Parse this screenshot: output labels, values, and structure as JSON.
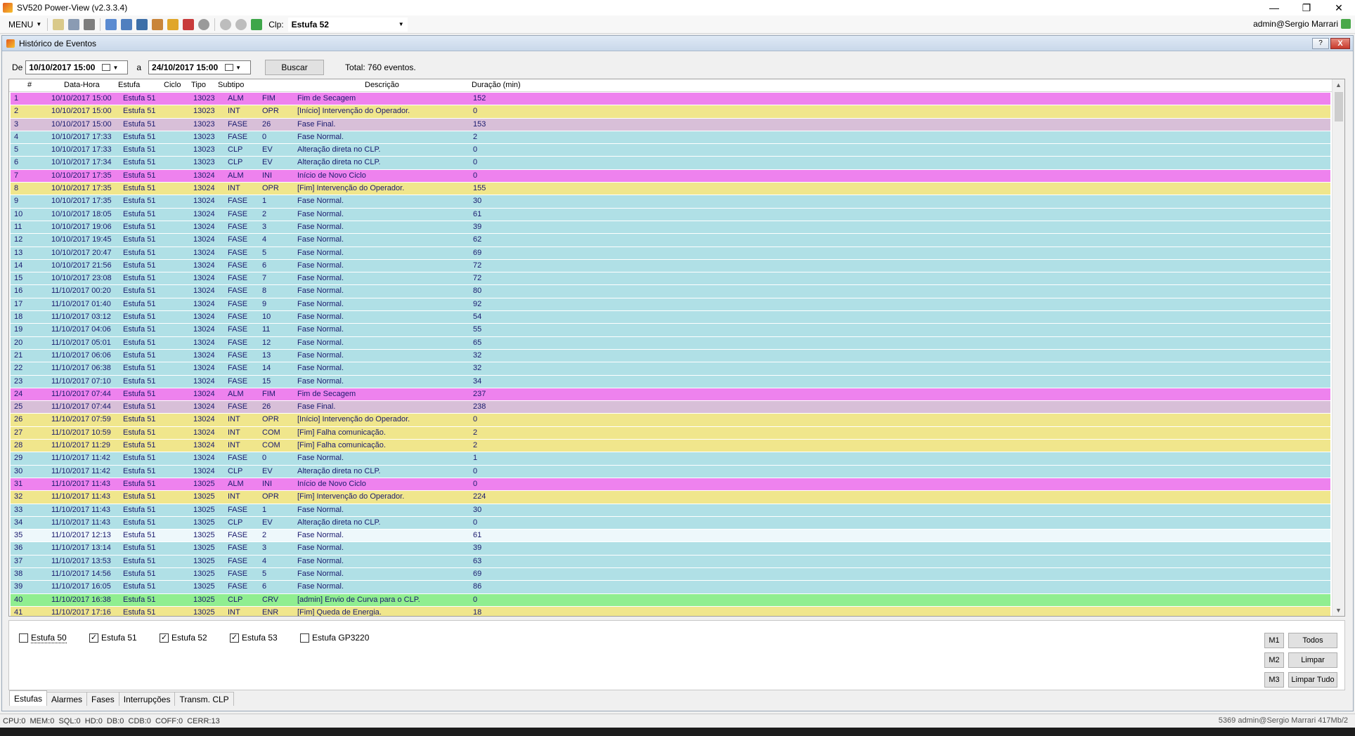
{
  "window": {
    "title": "SV520 Power-View (v2.3.3.4)",
    "minimize_glyph": "—",
    "restore_glyph": "❐",
    "close_glyph": "✕"
  },
  "toolbar": {
    "menu_label": "MENU",
    "clp_label": "Clp:",
    "clp_value": "Estufa 52",
    "user": "admin@Sergio Marrari"
  },
  "inner_window": {
    "title": "Histórico de Eventos",
    "help_label": "?",
    "close_label": "X"
  },
  "filter": {
    "from_label": "De",
    "from_value": "10/10/2017 15:00",
    "to_label": "a",
    "to_value": "24/10/2017 15:00",
    "search_label": "Buscar",
    "total_text": "Total: 760 eventos."
  },
  "grid": {
    "columns": [
      "#",
      "Data-Hora",
      "Estufa",
      "Ciclo",
      "Tipo",
      "Subtipo",
      "Descrição",
      "Duração (min)"
    ],
    "rows": [
      {
        "n": "1",
        "dt": "10/10/2017 15:00",
        "est": "Estufa 51",
        "ciclo": "13023",
        "tipo": "ALM",
        "sub": "FIM",
        "desc": "Fim de Secagem",
        "dur": "152",
        "color": "#ee82ee"
      },
      {
        "n": "2",
        "dt": "10/10/2017 15:00",
        "est": "Estufa 51",
        "ciclo": "13023",
        "tipo": "INT",
        "sub": "OPR",
        "desc": "[Início] Intervenção do Operador.",
        "dur": "0",
        "color": "#f0e68c"
      },
      {
        "n": "3",
        "dt": "10/10/2017 15:00",
        "est": "Estufa 51",
        "ciclo": "13023",
        "tipo": "FASE",
        "sub": "26",
        "desc": "Fase Final.",
        "dur": "153",
        "color": "#d8bfd8"
      },
      {
        "n": "4",
        "dt": "10/10/2017 17:33",
        "est": "Estufa 51",
        "ciclo": "13023",
        "tipo": "FASE",
        "sub": "0",
        "desc": "Fase Normal.",
        "dur": "2",
        "color": "#b0e0e6"
      },
      {
        "n": "5",
        "dt": "10/10/2017 17:33",
        "est": "Estufa 51",
        "ciclo": "13023",
        "tipo": "CLP",
        "sub": "EV",
        "desc": "Alteração direta no CLP.",
        "dur": "0",
        "color": "#b0e0e6"
      },
      {
        "n": "6",
        "dt": "10/10/2017 17:34",
        "est": "Estufa 51",
        "ciclo": "13023",
        "tipo": "CLP",
        "sub": "EV",
        "desc": "Alteração direta no CLP.",
        "dur": "0",
        "color": "#b0e0e6"
      },
      {
        "n": "7",
        "dt": "10/10/2017 17:35",
        "est": "Estufa 51",
        "ciclo": "13024",
        "tipo": "ALM",
        "sub": "INI",
        "desc": "Início de Novo Ciclo",
        "dur": "0",
        "color": "#ee82ee"
      },
      {
        "n": "8",
        "dt": "10/10/2017 17:35",
        "est": "Estufa 51",
        "ciclo": "13024",
        "tipo": "INT",
        "sub": "OPR",
        "desc": "[Fim] Intervenção do Operador.",
        "dur": "155",
        "color": "#f0e68c"
      },
      {
        "n": "9",
        "dt": "10/10/2017 17:35",
        "est": "Estufa 51",
        "ciclo": "13024",
        "tipo": "FASE",
        "sub": "1",
        "desc": "Fase Normal.",
        "dur": "30",
        "color": "#b0e0e6"
      },
      {
        "n": "10",
        "dt": "10/10/2017 18:05",
        "est": "Estufa 51",
        "ciclo": "13024",
        "tipo": "FASE",
        "sub": "2",
        "desc": "Fase Normal.",
        "dur": "61",
        "color": "#b0e0e6"
      },
      {
        "n": "11",
        "dt": "10/10/2017 19:06",
        "est": "Estufa 51",
        "ciclo": "13024",
        "tipo": "FASE",
        "sub": "3",
        "desc": "Fase Normal.",
        "dur": "39",
        "color": "#b0e0e6"
      },
      {
        "n": "12",
        "dt": "10/10/2017 19:45",
        "est": "Estufa 51",
        "ciclo": "13024",
        "tipo": "FASE",
        "sub": "4",
        "desc": "Fase Normal.",
        "dur": "62",
        "color": "#b0e0e6"
      },
      {
        "n": "13",
        "dt": "10/10/2017 20:47",
        "est": "Estufa 51",
        "ciclo": "13024",
        "tipo": "FASE",
        "sub": "5",
        "desc": "Fase Normal.",
        "dur": "69",
        "color": "#b0e0e6"
      },
      {
        "n": "14",
        "dt": "10/10/2017 21:56",
        "est": "Estufa 51",
        "ciclo": "13024",
        "tipo": "FASE",
        "sub": "6",
        "desc": "Fase Normal.",
        "dur": "72",
        "color": "#b0e0e6"
      },
      {
        "n": "15",
        "dt": "10/10/2017 23:08",
        "est": "Estufa 51",
        "ciclo": "13024",
        "tipo": "FASE",
        "sub": "7",
        "desc": "Fase Normal.",
        "dur": "72",
        "color": "#b0e0e6"
      },
      {
        "n": "16",
        "dt": "11/10/2017 00:20",
        "est": "Estufa 51",
        "ciclo": "13024",
        "tipo": "FASE",
        "sub": "8",
        "desc": "Fase Normal.",
        "dur": "80",
        "color": "#b0e0e6"
      },
      {
        "n": "17",
        "dt": "11/10/2017 01:40",
        "est": "Estufa 51",
        "ciclo": "13024",
        "tipo": "FASE",
        "sub": "9",
        "desc": "Fase Normal.",
        "dur": "92",
        "color": "#b0e0e6"
      },
      {
        "n": "18",
        "dt": "11/10/2017 03:12",
        "est": "Estufa 51",
        "ciclo": "13024",
        "tipo": "FASE",
        "sub": "10",
        "desc": "Fase Normal.",
        "dur": "54",
        "color": "#b0e0e6"
      },
      {
        "n": "19",
        "dt": "11/10/2017 04:06",
        "est": "Estufa 51",
        "ciclo": "13024",
        "tipo": "FASE",
        "sub": "11",
        "desc": "Fase Normal.",
        "dur": "55",
        "color": "#b0e0e6"
      },
      {
        "n": "20",
        "dt": "11/10/2017 05:01",
        "est": "Estufa 51",
        "ciclo": "13024",
        "tipo": "FASE",
        "sub": "12",
        "desc": "Fase Normal.",
        "dur": "65",
        "color": "#b0e0e6"
      },
      {
        "n": "21",
        "dt": "11/10/2017 06:06",
        "est": "Estufa 51",
        "ciclo": "13024",
        "tipo": "FASE",
        "sub": "13",
        "desc": "Fase Normal.",
        "dur": "32",
        "color": "#b0e0e6"
      },
      {
        "n": "22",
        "dt": "11/10/2017 06:38",
        "est": "Estufa 51",
        "ciclo": "13024",
        "tipo": "FASE",
        "sub": "14",
        "desc": "Fase Normal.",
        "dur": "32",
        "color": "#b0e0e6"
      },
      {
        "n": "23",
        "dt": "11/10/2017 07:10",
        "est": "Estufa 51",
        "ciclo": "13024",
        "tipo": "FASE",
        "sub": "15",
        "desc": "Fase Normal.",
        "dur": "34",
        "color": "#b0e0e6"
      },
      {
        "n": "24",
        "dt": "11/10/2017 07:44",
        "est": "Estufa 51",
        "ciclo": "13024",
        "tipo": "ALM",
        "sub": "FIM",
        "desc": "Fim de Secagem",
        "dur": "237",
        "color": "#ee82ee"
      },
      {
        "n": "25",
        "dt": "11/10/2017 07:44",
        "est": "Estufa 51",
        "ciclo": "13024",
        "tipo": "FASE",
        "sub": "26",
        "desc": "Fase Final.",
        "dur": "238",
        "color": "#d8bfd8"
      },
      {
        "n": "26",
        "dt": "11/10/2017 07:59",
        "est": "Estufa 51",
        "ciclo": "13024",
        "tipo": "INT",
        "sub": "OPR",
        "desc": "[Início] Intervenção do Operador.",
        "dur": "0",
        "color": "#f0e68c"
      },
      {
        "n": "27",
        "dt": "11/10/2017 10:59",
        "est": "Estufa 51",
        "ciclo": "13024",
        "tipo": "INT",
        "sub": "COM",
        "desc": "[Fim] Falha comunicação.",
        "dur": "2",
        "color": "#f0e68c"
      },
      {
        "n": "28",
        "dt": "11/10/2017 11:29",
        "est": "Estufa 51",
        "ciclo": "13024",
        "tipo": "INT",
        "sub": "COM",
        "desc": "[Fim] Falha comunicação.",
        "dur": "2",
        "color": "#f0e68c"
      },
      {
        "n": "29",
        "dt": "11/10/2017 11:42",
        "est": "Estufa 51",
        "ciclo": "13024",
        "tipo": "FASE",
        "sub": "0",
        "desc": "Fase Normal.",
        "dur": "1",
        "color": "#b0e0e6"
      },
      {
        "n": "30",
        "dt": "11/10/2017 11:42",
        "est": "Estufa 51",
        "ciclo": "13024",
        "tipo": "CLP",
        "sub": "EV",
        "desc": "Alteração direta no CLP.",
        "dur": "0",
        "color": "#b0e0e6"
      },
      {
        "n": "31",
        "dt": "11/10/2017 11:43",
        "est": "Estufa 51",
        "ciclo": "13025",
        "tipo": "ALM",
        "sub": "INI",
        "desc": "Início de Novo Ciclo",
        "dur": "0",
        "color": "#ee82ee"
      },
      {
        "n": "32",
        "dt": "11/10/2017 11:43",
        "est": "Estufa 51",
        "ciclo": "13025",
        "tipo": "INT",
        "sub": "OPR",
        "desc": "[Fim] Intervenção do Operador.",
        "dur": "224",
        "color": "#f0e68c"
      },
      {
        "n": "33",
        "dt": "11/10/2017 11:43",
        "est": "Estufa 51",
        "ciclo": "13025",
        "tipo": "FASE",
        "sub": "1",
        "desc": "Fase Normal.",
        "dur": "30",
        "color": "#b0e0e6"
      },
      {
        "n": "34",
        "dt": "11/10/2017 11:43",
        "est": "Estufa 51",
        "ciclo": "13025",
        "tipo": "CLP",
        "sub": "EV",
        "desc": "Alteração direta no CLP.",
        "dur": "0",
        "color": "#b0e0e6"
      },
      {
        "n": "35",
        "dt": "11/10/2017 12:13",
        "est": "Estufa 51",
        "ciclo": "13025",
        "tipo": "FASE",
        "sub": "2",
        "desc": "Fase Normal.",
        "dur": "61",
        "color": "#eef8fb"
      },
      {
        "n": "36",
        "dt": "11/10/2017 13:14",
        "est": "Estufa 51",
        "ciclo": "13025",
        "tipo": "FASE",
        "sub": "3",
        "desc": "Fase Normal.",
        "dur": "39",
        "color": "#b0e0e6"
      },
      {
        "n": "37",
        "dt": "11/10/2017 13:53",
        "est": "Estufa 51",
        "ciclo": "13025",
        "tipo": "FASE",
        "sub": "4",
        "desc": "Fase Normal.",
        "dur": "63",
        "color": "#b0e0e6"
      },
      {
        "n": "38",
        "dt": "11/10/2017 14:56",
        "est": "Estufa 51",
        "ciclo": "13025",
        "tipo": "FASE",
        "sub": "5",
        "desc": "Fase Normal.",
        "dur": "69",
        "color": "#b0e0e6"
      },
      {
        "n": "39",
        "dt": "11/10/2017 16:05",
        "est": "Estufa 51",
        "ciclo": "13025",
        "tipo": "FASE",
        "sub": "6",
        "desc": "Fase Normal.",
        "dur": "86",
        "color": "#b0e0e6"
      },
      {
        "n": "40",
        "dt": "11/10/2017 16:38",
        "est": "Estufa 51",
        "ciclo": "13025",
        "tipo": "CLP",
        "sub": "CRV",
        "desc": "[admin] Envio de Curva para o CLP.",
        "dur": "0",
        "color": "#90ee90"
      },
      {
        "n": "41",
        "dt": "11/10/2017 17:16",
        "est": "Estufa 51",
        "ciclo": "13025",
        "tipo": "INT",
        "sub": "ENR",
        "desc": "[Fim] Queda de Energia.",
        "dur": "18",
        "color": "#f0e68c"
      }
    ]
  },
  "checkboxes": [
    {
      "label": "Estufa 50",
      "checked": false
    },
    {
      "label": "Estufa 51",
      "checked": true
    },
    {
      "label": "Estufa 52",
      "checked": true
    },
    {
      "label": "Estufa 53",
      "checked": true
    },
    {
      "label": "Estufa GP3220",
      "checked": false
    }
  ],
  "side_buttons": {
    "m1": "M1",
    "m2": "M2",
    "m3": "M3",
    "todos": "Todos",
    "limpar": "Limpar",
    "limpar_tudo": "Limpar Tudo"
  },
  "tabs": [
    "Estufas",
    "Alarmes",
    "Fases",
    "Interrupções",
    "Transm. CLP"
  ],
  "status": {
    "left": "CPU:0  MEM:0  SQL:0  HD:0  DB:0  CDB:0  COFF:0  CERR:13",
    "right": "5369 admin@Sergio Marrari  417Mb/2"
  }
}
